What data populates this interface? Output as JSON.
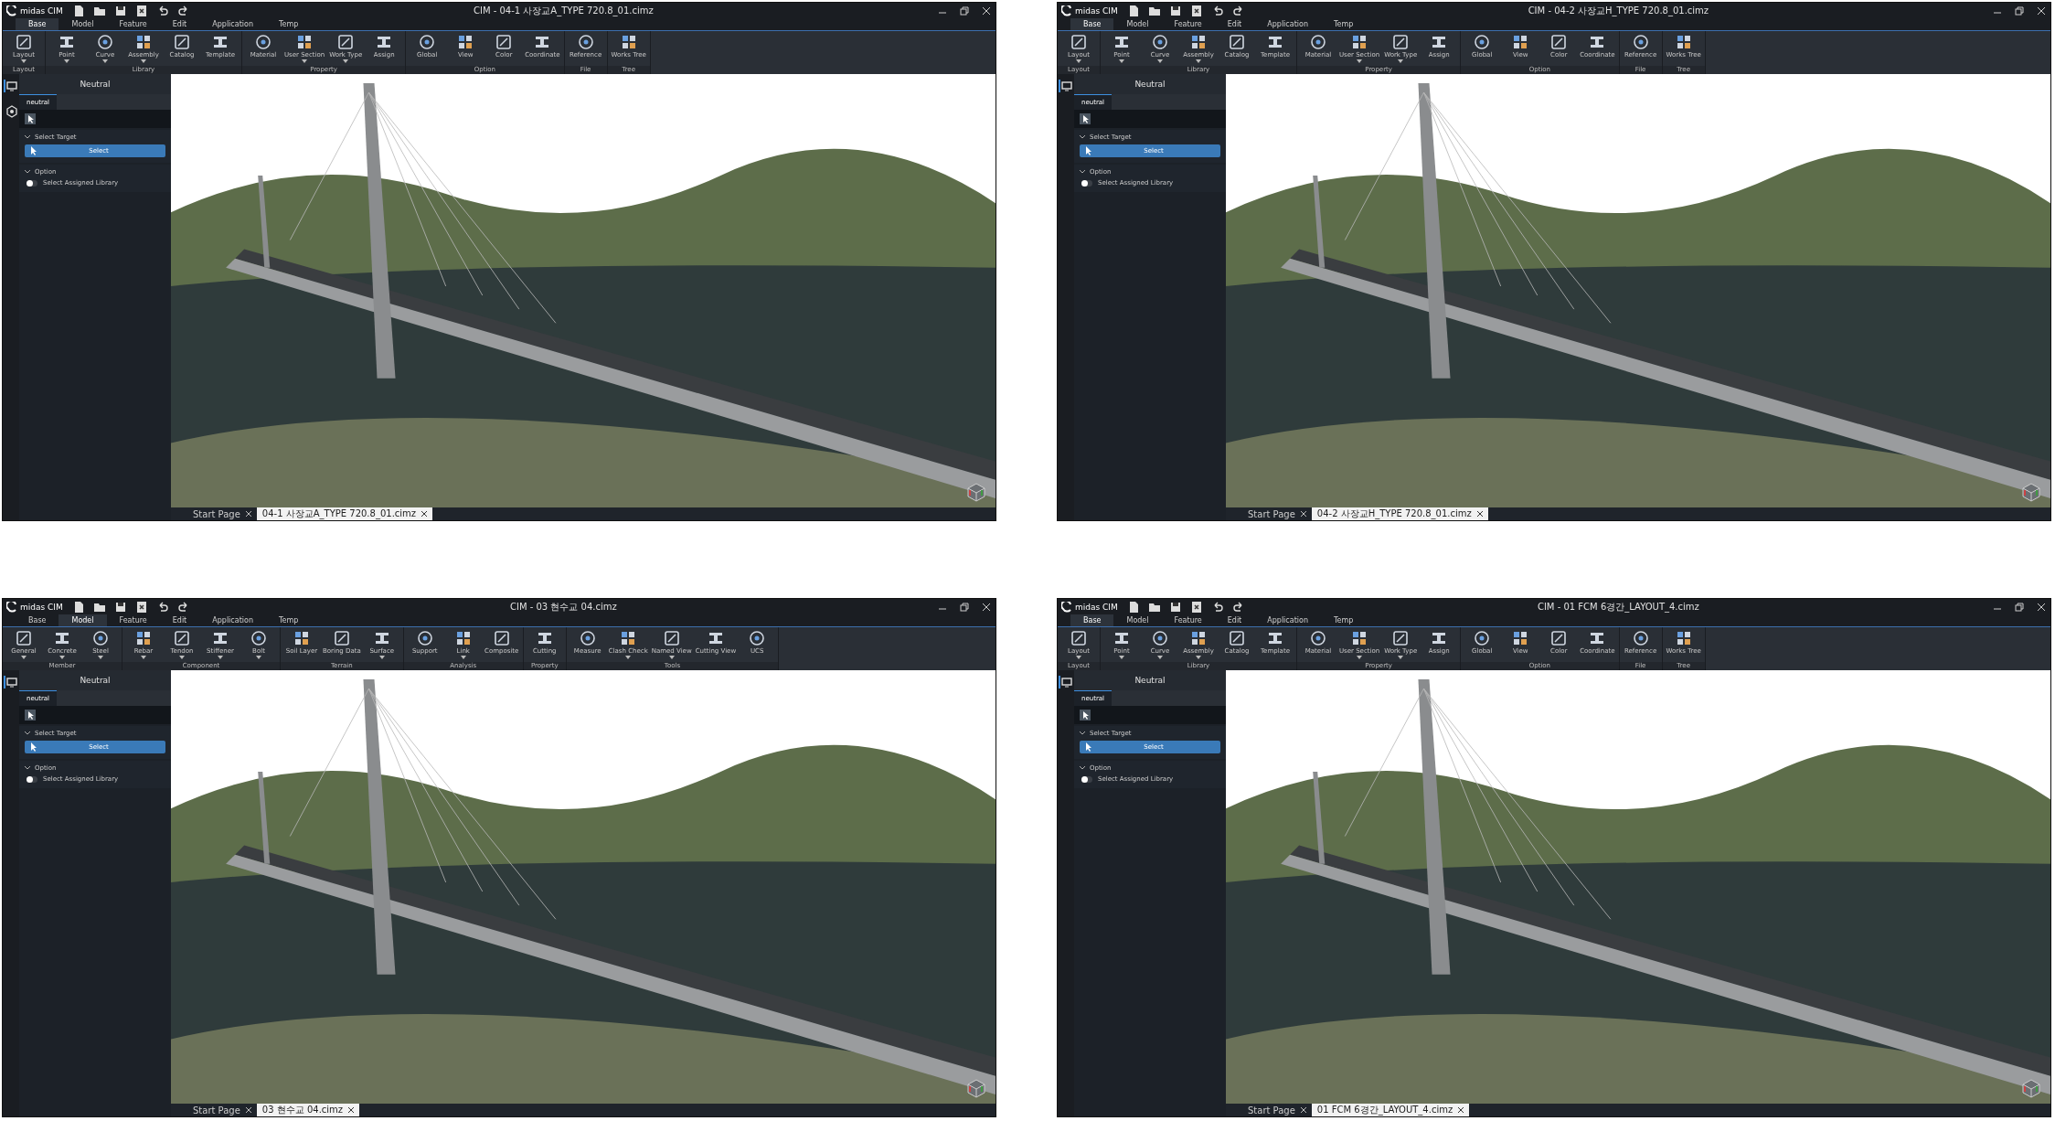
{
  "windows": [
    {
      "app_name": "midas CIM",
      "title": "CIM - 04-1 사장교A_TYPE 720.8_01.cimz",
      "menu_tabs": [
        {
          "label": "Base",
          "selected": true
        },
        {
          "label": "Model",
          "selected": false
        },
        {
          "label": "Feature",
          "selected": false
        },
        {
          "label": "Edit",
          "selected": false
        },
        {
          "label": "Application",
          "selected": false
        },
        {
          "label": "Temp",
          "selected": false
        }
      ],
      "ribbon_groups": [
        {
          "label": "Layout",
          "items": [
            {
              "label": "Layout",
              "dropdown": true
            }
          ]
        },
        {
          "label": "Library",
          "items": [
            {
              "label": "Point",
              "dropdown": true
            },
            {
              "label": "Curve",
              "dropdown": true
            },
            {
              "label": "Assembly",
              "dropdown": true
            },
            {
              "label": "Catalog",
              "dropdown": false
            },
            {
              "label": "Template",
              "dropdown": false
            }
          ]
        },
        {
          "label": "Property",
          "items": [
            {
              "label": "Material",
              "dropdown": false
            },
            {
              "label": "User Section",
              "dropdown": true
            },
            {
              "label": "Work Type",
              "dropdown": true
            },
            {
              "label": "Assign",
              "dropdown": false
            }
          ]
        },
        {
          "label": "Option",
          "items": [
            {
              "label": "Global",
              "dropdown": false
            },
            {
              "label": "View",
              "dropdown": false
            },
            {
              "label": "Color",
              "dropdown": false
            },
            {
              "label": "Coordinate",
              "dropdown": false
            }
          ]
        },
        {
          "label": "File",
          "items": [
            {
              "label": "Reference",
              "dropdown": false
            }
          ]
        },
        {
          "label": "Tree",
          "items": [
            {
              "label": "Works Tree",
              "dropdown": false
            }
          ]
        }
      ],
      "side_tabs": [
        {
          "kind": "view",
          "selected": true
        },
        {
          "kind": "model",
          "selected": false
        }
      ],
      "panel": {
        "header": "Neutral",
        "tabs": [
          {
            "label": "neutral",
            "selected": true
          }
        ],
        "sections": [
          {
            "title": "Select Target",
            "expanded": true,
            "kind": "button",
            "label": "Select"
          },
          {
            "title": "Option",
            "expanded": true,
            "kind": "toggle",
            "label": "Select Assigned Library",
            "on": false
          }
        ]
      },
      "doc_tabs": [
        {
          "label": "Start Page",
          "selected": false
        },
        {
          "label": "04-1 사장교A_TYPE 720.8_01.cimz",
          "selected": true
        }
      ]
    },
    {
      "app_name": "midas CIM",
      "title": "CIM - 04-2 사장교H_TYPE 720.8_01.cimz",
      "menu_tabs": [
        {
          "label": "Base",
          "selected": true
        },
        {
          "label": "Model",
          "selected": false
        },
        {
          "label": "Feature",
          "selected": false
        },
        {
          "label": "Edit",
          "selected": false
        },
        {
          "label": "Application",
          "selected": false
        },
        {
          "label": "Temp",
          "selected": false
        }
      ],
      "ribbon_groups": [
        {
          "label": "Layout",
          "items": [
            {
              "label": "Layout",
              "dropdown": true
            }
          ]
        },
        {
          "label": "Library",
          "items": [
            {
              "label": "Point",
              "dropdown": true
            },
            {
              "label": "Curve",
              "dropdown": true
            },
            {
              "label": "Assembly",
              "dropdown": true
            },
            {
              "label": "Catalog",
              "dropdown": false
            },
            {
              "label": "Template",
              "dropdown": false
            }
          ]
        },
        {
          "label": "Property",
          "items": [
            {
              "label": "Material",
              "dropdown": false
            },
            {
              "label": "User Section",
              "dropdown": true
            },
            {
              "label": "Work Type",
              "dropdown": true
            },
            {
              "label": "Assign",
              "dropdown": false
            }
          ]
        },
        {
          "label": "Option",
          "items": [
            {
              "label": "Global",
              "dropdown": false
            },
            {
              "label": "View",
              "dropdown": false
            },
            {
              "label": "Color",
              "dropdown": false
            },
            {
              "label": "Coordinate",
              "dropdown": false
            }
          ]
        },
        {
          "label": "File",
          "items": [
            {
              "label": "Reference",
              "dropdown": false
            }
          ]
        },
        {
          "label": "Tree",
          "items": [
            {
              "label": "Works Tree",
              "dropdown": false
            }
          ]
        }
      ],
      "side_tabs": [
        {
          "kind": "view",
          "selected": true
        }
      ],
      "panel": {
        "header": "Neutral",
        "tabs": [
          {
            "label": "neutral",
            "selected": true
          }
        ],
        "sections": [
          {
            "title": "Select Target",
            "expanded": true,
            "kind": "button",
            "label": "Select"
          },
          {
            "title": "Option",
            "expanded": true,
            "kind": "toggle",
            "label": "Select Assigned Library",
            "on": false
          }
        ]
      },
      "doc_tabs": [
        {
          "label": "Start Page",
          "selected": false
        },
        {
          "label": "04-2 사장교H_TYPE 720.8_01.cimz",
          "selected": true
        }
      ]
    },
    {
      "app_name": "midas CIM",
      "title": "CIM - 03 현수교 04.cimz",
      "menu_tabs": [
        {
          "label": "Base",
          "selected": false
        },
        {
          "label": "Model",
          "selected": true
        },
        {
          "label": "Feature",
          "selected": false
        },
        {
          "label": "Edit",
          "selected": false
        },
        {
          "label": "Application",
          "selected": false
        },
        {
          "label": "Temp",
          "selected": false
        }
      ],
      "ribbon_groups": [
        {
          "label": "Member",
          "items": [
            {
              "label": "General",
              "dropdown": true
            },
            {
              "label": "Concrete",
              "dropdown": true
            },
            {
              "label": "Steel",
              "dropdown": true
            }
          ]
        },
        {
          "label": "Component",
          "items": [
            {
              "label": "Rebar",
              "dropdown": true
            },
            {
              "label": "Tendon",
              "dropdown": true
            },
            {
              "label": "Stiffener",
              "dropdown": true
            },
            {
              "label": "Bolt",
              "dropdown": true
            }
          ]
        },
        {
          "label": "Terrain",
          "items": [
            {
              "label": "Soil Layer",
              "dropdown": false
            },
            {
              "label": "Boring Data",
              "dropdown": false
            },
            {
              "label": "Surface",
              "dropdown": true
            }
          ]
        },
        {
          "label": "Analysis",
          "items": [
            {
              "label": "Support",
              "dropdown": false
            },
            {
              "label": "Link",
              "dropdown": true
            },
            {
              "label": "Composite",
              "dropdown": false
            }
          ]
        },
        {
          "label": "Property",
          "items": [
            {
              "label": "Cutting",
              "dropdown": false
            }
          ]
        },
        {
          "label": "Tools",
          "items": [
            {
              "label": "Measure",
              "dropdown": false
            },
            {
              "label": "Clash Check",
              "dropdown": true
            },
            {
              "label": "Named View",
              "dropdown": true
            },
            {
              "label": "Cutting View",
              "dropdown": false
            },
            {
              "label": "UCS",
              "dropdown": false
            }
          ]
        }
      ],
      "side_tabs": [
        {
          "kind": "view",
          "selected": true
        }
      ],
      "panel": {
        "header": "Neutral",
        "tabs": [
          {
            "label": "neutral",
            "selected": true
          }
        ],
        "sections": [
          {
            "title": "Select Target",
            "expanded": true,
            "kind": "button",
            "label": "Select"
          },
          {
            "title": "Option",
            "expanded": true,
            "kind": "toggle",
            "label": "Select Assigned Library",
            "on": false
          }
        ]
      },
      "doc_tabs": [
        {
          "label": "Start Page",
          "selected": false
        },
        {
          "label": "03 현수교 04.cimz",
          "selected": true
        }
      ]
    },
    {
      "app_name": "midas CIM",
      "title": "CIM - 01 FCM 6경간_LAYOUT_4.cimz",
      "menu_tabs": [
        {
          "label": "Base",
          "selected": true
        },
        {
          "label": "Model",
          "selected": false
        },
        {
          "label": "Feature",
          "selected": false
        },
        {
          "label": "Edit",
          "selected": false
        },
        {
          "label": "Application",
          "selected": false
        },
        {
          "label": "Temp",
          "selected": false
        }
      ],
      "ribbon_groups": [
        {
          "label": "Layout",
          "items": [
            {
              "label": "Layout",
              "dropdown": true
            }
          ]
        },
        {
          "label": "Library",
          "items": [
            {
              "label": "Point",
              "dropdown": true
            },
            {
              "label": "Curve",
              "dropdown": true
            },
            {
              "label": "Assembly",
              "dropdown": true
            },
            {
              "label": "Catalog",
              "dropdown": false
            },
            {
              "label": "Template",
              "dropdown": false
            }
          ]
        },
        {
          "label": "Property",
          "items": [
            {
              "label": "Material",
              "dropdown": false
            },
            {
              "label": "User Section",
              "dropdown": true
            },
            {
              "label": "Work Type",
              "dropdown": true
            },
            {
              "label": "Assign",
              "dropdown": false
            }
          ]
        },
        {
          "label": "Option",
          "items": [
            {
              "label": "Global",
              "dropdown": false
            },
            {
              "label": "View",
              "dropdown": false
            },
            {
              "label": "Color",
              "dropdown": false
            },
            {
              "label": "Coordinate",
              "dropdown": false
            }
          ]
        },
        {
          "label": "File",
          "items": [
            {
              "label": "Reference",
              "dropdown": false
            }
          ]
        },
        {
          "label": "Tree",
          "items": [
            {
              "label": "Works Tree",
              "dropdown": false
            }
          ]
        }
      ],
      "side_tabs": [
        {
          "kind": "view",
          "selected": true
        }
      ],
      "panel": {
        "header": "Neutral",
        "tabs": [
          {
            "label": "neutral",
            "selected": true
          }
        ],
        "sections": [
          {
            "title": "Select Target",
            "expanded": true,
            "kind": "button",
            "label": "Select"
          },
          {
            "title": "Option",
            "expanded": true,
            "kind": "toggle",
            "label": "Select Assigned Library",
            "on": false
          }
        ]
      },
      "doc_tabs": [
        {
          "label": "Start Page",
          "selected": false
        },
        {
          "label": "01 FCM 6경간_LAYOUT_4.cimz",
          "selected": true
        }
      ]
    }
  ]
}
